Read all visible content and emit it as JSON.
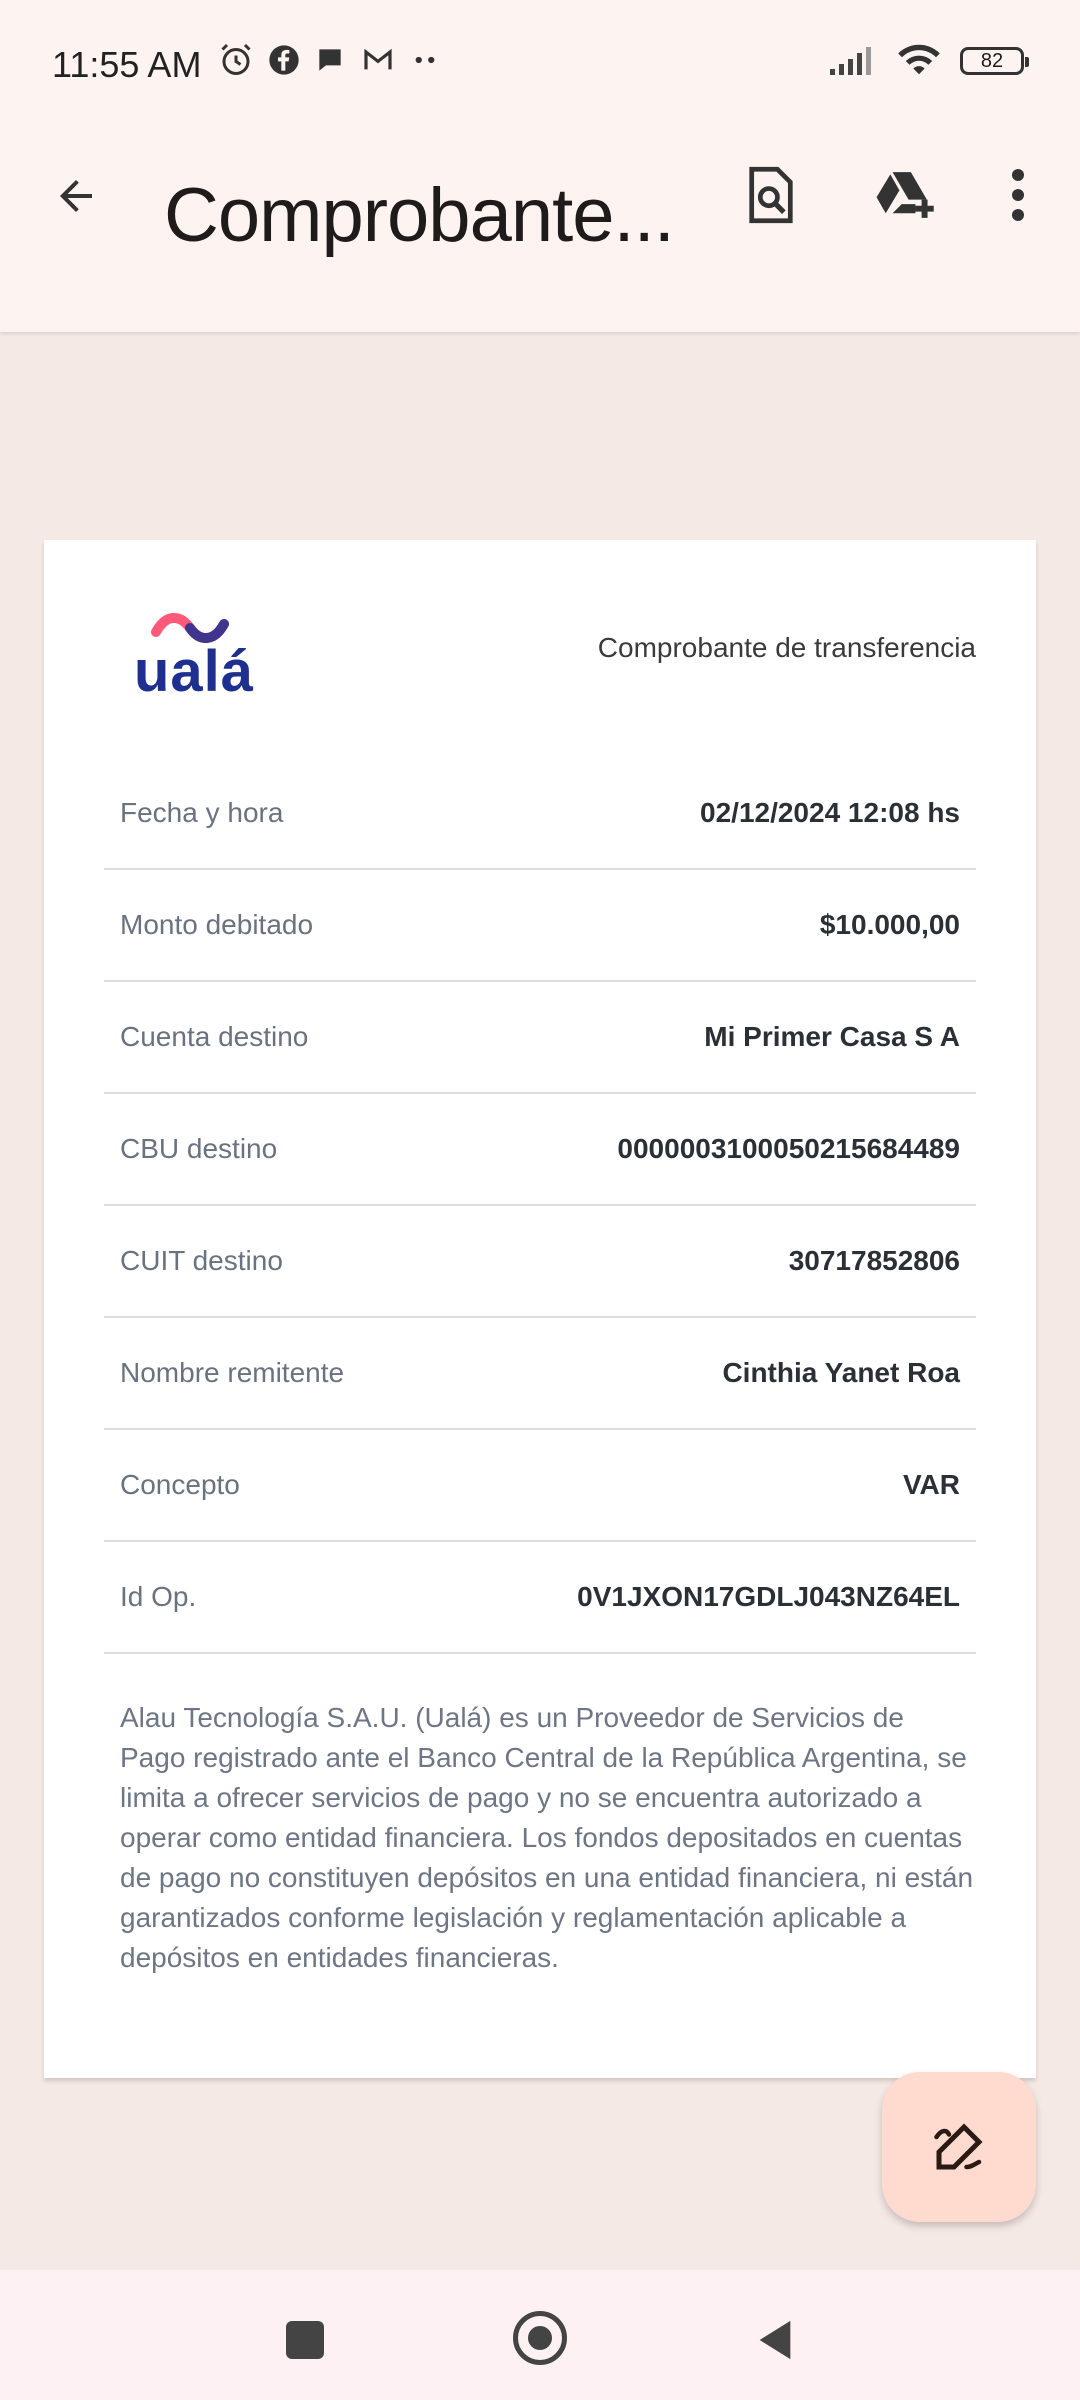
{
  "status_bar": {
    "time": "11:55 AM",
    "battery": "82"
  },
  "app_bar": {
    "title": "Comprobante..."
  },
  "document": {
    "brand": "ualá",
    "header": "Comprobante de transferencia",
    "rows": [
      {
        "label": "Fecha y hora",
        "value": "02/12/2024 12:08 hs"
      },
      {
        "label": "Monto debitado",
        "value": "$10.000,00"
      },
      {
        "label": "Cuenta destino",
        "value": "Mi Primer Casa S A"
      },
      {
        "label": "CBU destino",
        "value": "0000003100050215684489"
      },
      {
        "label": "CUIT destino",
        "value": "30717852806"
      },
      {
        "label": "Nombre remitente",
        "value": "Cinthia Yanet Roa"
      },
      {
        "label": "Concepto",
        "value": "VAR"
      },
      {
        "label": "Id Op.",
        "value": "0V1JXON17GDLJ043NZ64EL"
      }
    ],
    "disclaimer": "Alau Tecnología S.A.U. (Ualá) es un Proveedor de Servicios de Pago registrado ante el Banco Central de la República Argentina, se limita a ofrecer servicios de pago y no se encuentra autorizado a operar como entidad financiera. Los fondos depositados en cuentas de pago no constituyen depósitos en una entidad financiera, ni están garantizados conforme legislación y reglamentación aplicable a depósitos en entidades financieras."
  },
  "colors": {
    "brand_blue": "#1e2f8f",
    "brand_pink": "#ff5a7a",
    "fab_bg": "#ffdbcf",
    "background": "#f5e9e5"
  }
}
